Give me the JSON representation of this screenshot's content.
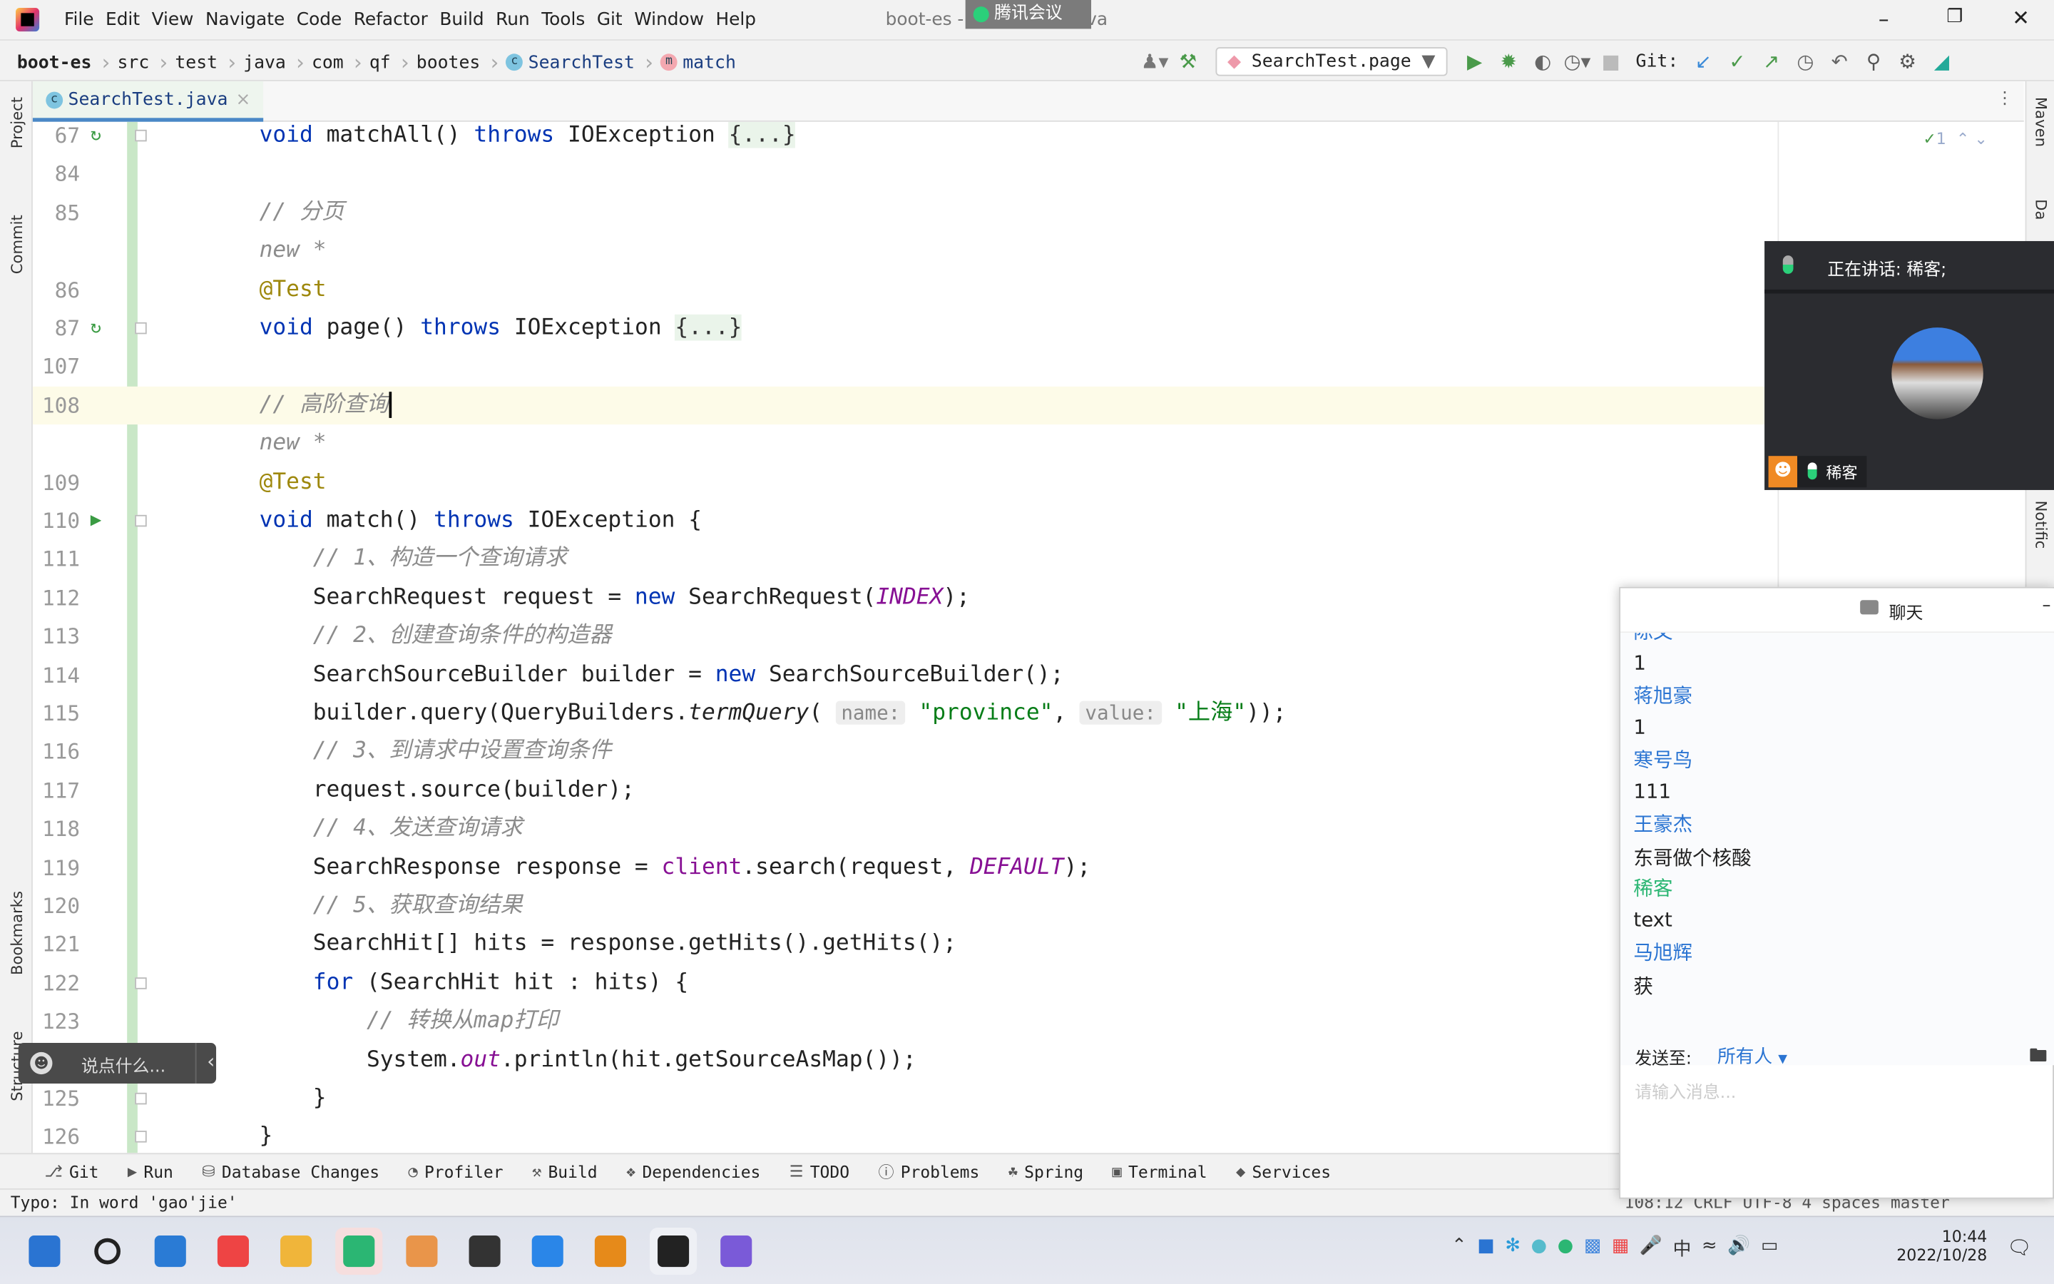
{
  "window": {
    "title": "boot-es - SearchTest.java",
    "menu": [
      "File",
      "Edit",
      "View",
      "Navigate",
      "Code",
      "Refactor",
      "Build",
      "Run",
      "Tools",
      "Git",
      "Window",
      "Help"
    ],
    "controls": [
      "minimize",
      "restore",
      "close"
    ]
  },
  "meeting": {
    "app_tag": "腾讯会议",
    "speaking": "正在讲话: 稀客;",
    "participant": "稀客"
  },
  "breadcrumb": [
    "boot-es",
    "src",
    "test",
    "java",
    "com",
    "qf",
    "bootes",
    "SearchTest",
    "match"
  ],
  "toolbar": {
    "run_config": "SearchTest.page",
    "git_label": "Git:"
  },
  "tab": {
    "label": "SearchTest.java"
  },
  "left_strip": [
    "Project",
    "Commit",
    "Bookmarks",
    "Structure"
  ],
  "right_strip": [
    "Maven",
    "Da",
    "Notific"
  ],
  "inspection": {
    "count": "1"
  },
  "code": [
    {
      "n": "67",
      "g": "run",
      "fold": true,
      "cur": false,
      "tokens": [
        [
          "    ",
          ""
        ],
        [
          "void ",
          "k"
        ],
        [
          "matchAll() ",
          ""
        ],
        [
          "throws ",
          "k"
        ],
        [
          "IOException ",
          ""
        ],
        [
          "{...}",
          "fold"
        ]
      ]
    },
    {
      "n": "84",
      "tokens": []
    },
    {
      "n": "85",
      "tokens": [
        [
          "    ",
          ""
        ],
        [
          "// 分页",
          "cm"
        ]
      ]
    },
    {
      "n": "",
      "tokens": [
        [
          "    ",
          ""
        ],
        [
          "new *",
          "cm"
        ]
      ]
    },
    {
      "n": "86",
      "tokens": [
        [
          "    ",
          ""
        ],
        [
          "@Test",
          "an"
        ]
      ]
    },
    {
      "n": "87",
      "g": "run",
      "fold": true,
      "tokens": [
        [
          "    ",
          ""
        ],
        [
          "void ",
          "k"
        ],
        [
          "page() ",
          ""
        ],
        [
          "throws ",
          "k"
        ],
        [
          "IOException ",
          ""
        ],
        [
          "{...}",
          "fold"
        ]
      ]
    },
    {
      "n": "107",
      "tokens": []
    },
    {
      "n": "108",
      "cur": true,
      "tokens": [
        [
          "    ",
          ""
        ],
        [
          "// 高阶查询",
          "cm"
        ]
      ]
    },
    {
      "n": "",
      "tokens": [
        [
          "    ",
          ""
        ],
        [
          "new *",
          "cm"
        ]
      ]
    },
    {
      "n": "109",
      "tokens": [
        [
          "    ",
          ""
        ],
        [
          "@Test",
          "an"
        ]
      ]
    },
    {
      "n": "110",
      "g": "play",
      "fold": true,
      "tokens": [
        [
          "    ",
          ""
        ],
        [
          "void ",
          "k"
        ],
        [
          "match() ",
          ""
        ],
        [
          "throws ",
          "k"
        ],
        [
          "IOException {",
          ""
        ]
      ]
    },
    {
      "n": "111",
      "tokens": [
        [
          "        ",
          ""
        ],
        [
          "// 1、构造一个查询请求",
          "cm"
        ]
      ]
    },
    {
      "n": "112",
      "tokens": [
        [
          "        SearchRequest request = ",
          ""
        ],
        [
          "new ",
          "k"
        ],
        [
          "SearchRequest(",
          ""
        ],
        [
          "INDEX",
          "st"
        ],
        [
          ");",
          ""
        ]
      ]
    },
    {
      "n": "113",
      "tokens": [
        [
          "        ",
          ""
        ],
        [
          "// 2、创建查询条件的构造器",
          "cm"
        ]
      ]
    },
    {
      "n": "114",
      "tokens": [
        [
          "        SearchSourceBuilder builder = ",
          ""
        ],
        [
          "new ",
          "k"
        ],
        [
          "SearchSourceBuilder();",
          ""
        ]
      ]
    },
    {
      "n": "115",
      "tokens": [
        [
          "        builder.query(QueryBuilders.",
          ""
        ],
        [
          "termQuery",
          "it"
        ],
        [
          "( ",
          ""
        ],
        [
          "name:",
          "hint"
        ],
        [
          " ",
          ""
        ],
        [
          "\"province\"",
          "s"
        ],
        [
          ", ",
          ""
        ],
        [
          "value:",
          "hint"
        ],
        [
          " ",
          ""
        ],
        [
          "\"上海\"",
          "s"
        ],
        [
          "));",
          ""
        ]
      ]
    },
    {
      "n": "116",
      "tokens": [
        [
          "        ",
          ""
        ],
        [
          "// 3、到请求中设置查询条件",
          "cm"
        ]
      ]
    },
    {
      "n": "117",
      "tokens": [
        [
          "        request.source(builder);",
          ""
        ]
      ]
    },
    {
      "n": "118",
      "tokens": [
        [
          "        ",
          ""
        ],
        [
          "// 4、发送查询请求",
          "cm"
        ]
      ]
    },
    {
      "n": "119",
      "tokens": [
        [
          "        SearchResponse response = ",
          ""
        ],
        [
          "client",
          "f"
        ],
        [
          ".search(request, ",
          ""
        ],
        [
          "DEFAULT",
          "st"
        ],
        [
          ");",
          ""
        ]
      ]
    },
    {
      "n": "120",
      "tokens": [
        [
          "        ",
          ""
        ],
        [
          "// 5、获取查询结果",
          "cm"
        ]
      ]
    },
    {
      "n": "121",
      "tokens": [
        [
          "        SearchHit[] hits = response.getHits().getHits();",
          ""
        ]
      ]
    },
    {
      "n": "122",
      "fold": true,
      "tokens": [
        [
          "        ",
          ""
        ],
        [
          "for ",
          "k"
        ],
        [
          "(SearchHit hit : hits) {",
          ""
        ]
      ]
    },
    {
      "n": "123",
      "tokens": [
        [
          "            ",
          ""
        ],
        [
          "// 转换从map打印",
          "cm"
        ]
      ]
    },
    {
      "n": "124",
      "tokens": [
        [
          "            System.",
          ""
        ],
        [
          "out",
          "st"
        ],
        [
          ".println(hit.getSourceAsMap());",
          ""
        ]
      ]
    },
    {
      "n": "125",
      "fold": true,
      "tokens": [
        [
          "        }",
          ""
        ]
      ]
    },
    {
      "n": "126",
      "fold": true,
      "tokens": [
        [
          "    }",
          ""
        ]
      ]
    }
  ],
  "overlay_pill": {
    "placeholder": "说点什么..."
  },
  "bottom_tools": [
    "Git",
    "Run",
    "Database Changes",
    "Profiler",
    "Build",
    "Dependencies",
    "TODO",
    "Problems",
    "Spring",
    "Terminal",
    "Services"
  ],
  "status": {
    "message": "Typo: In word 'gao'jie'",
    "position": "108:12",
    "line_sep": "CRLF",
    "encoding": "UTF-8",
    "indent": "4 spaces",
    "branch": "master"
  },
  "chat": {
    "title": "聊天",
    "partial_name": "陈文",
    "messages": [
      {
        "name": "",
        "text": "1"
      },
      {
        "name": "蒋旭豪",
        "text": "1"
      },
      {
        "name": "寒号鸟",
        "text": "111"
      },
      {
        "name": "王豪杰",
        "text": "东哥做个核酸"
      },
      {
        "name": "稀客",
        "self": true,
        "text": "text"
      },
      {
        "name": "马旭辉",
        "text": "获"
      }
    ],
    "send_to_label": "发送至:",
    "send_to_value": "所有人",
    "input_placeholder": "请输入消息..."
  },
  "taskbar": {
    "apps": [
      "start",
      "search",
      "vscode",
      "chrome",
      "explorer",
      "wechat",
      "app-orange",
      "sublime",
      "app-blue",
      "app-link",
      "intellij",
      "obsidian"
    ],
    "time": "10:44",
    "date": "2022/10/28",
    "ime": "中"
  },
  "colors": {
    "keyword": "#0033b3",
    "comment": "#8c8c8c",
    "string": "#067d17",
    "annotation": "#9e880d",
    "chat_name": "#2a74d2",
    "chat_self": "#2bb673"
  }
}
